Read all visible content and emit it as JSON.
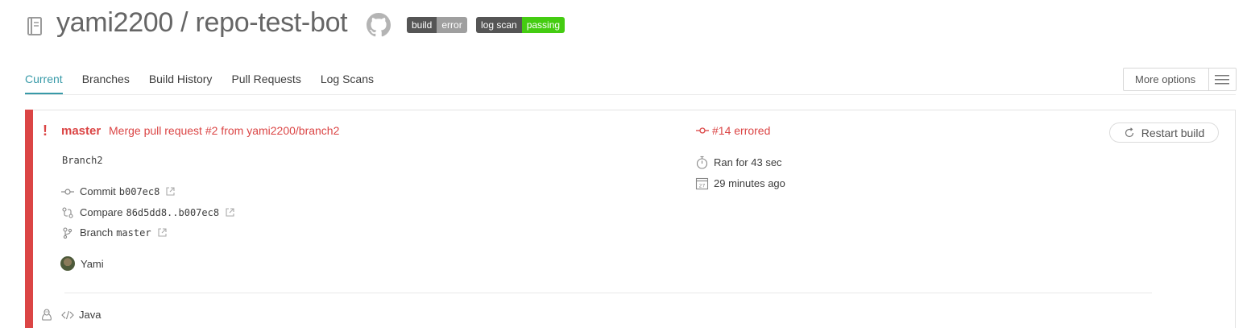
{
  "repo": {
    "owner": "yami2200",
    "name": "repo-test-bot",
    "title": "yami2200 / repo-test-bot",
    "icons": {
      "repo": "repo-book-icon",
      "github": "github-octocat-icon"
    }
  },
  "badges": {
    "build": {
      "label": "build",
      "status": "error",
      "color": "#9f9f9f"
    },
    "log_scan": {
      "label": "log scan",
      "status": "passing",
      "color": "#44cc11"
    }
  },
  "tabs": [
    {
      "label": "Current",
      "active": true
    },
    {
      "label": "Branches",
      "active": false
    },
    {
      "label": "Build History",
      "active": false
    },
    {
      "label": "Pull Requests",
      "active": false
    },
    {
      "label": "Log Scans",
      "active": false
    }
  ],
  "more_options": {
    "label": "More options",
    "icon": "hamburger-menu-icon"
  },
  "build": {
    "state_color": "#db4545",
    "branch": "master",
    "commit_message": "Merge pull request #2 from yami2200/branch2",
    "commit_body": "Branch2",
    "commit": {
      "label": "Commit",
      "value": "b007ec8"
    },
    "compare": {
      "label": "Compare",
      "value": "86d5dd8..b007ec8"
    },
    "branch_ref": {
      "label": "Branch",
      "value": "master"
    },
    "author": "Yami",
    "number_status": "#14 errored",
    "duration": "Ran for 43 sec",
    "finished": "29 minutes ago",
    "restart_label": "Restart build",
    "language": "Java",
    "os_icon": "linux-tux-icon"
  },
  "accent_color": "#389aa8"
}
